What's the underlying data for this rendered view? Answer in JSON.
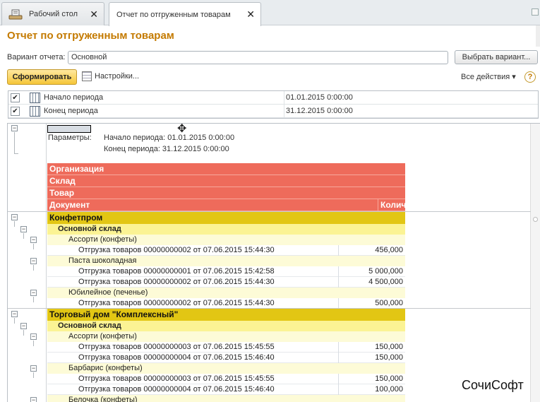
{
  "tabs": [
    {
      "label": "Рабочий стол",
      "active": false
    },
    {
      "label": "Отчет по отгруженным товарам",
      "active": true
    }
  ],
  "page_title": "Отчет по отгруженным товарам",
  "variant": {
    "label": "Вариант отчета:",
    "value": "Основной",
    "choose_button": "Выбрать вариант..."
  },
  "toolbar": {
    "generate": "Сформировать",
    "settings": "Настройки...",
    "all_actions": "Все действия ▾",
    "help": "?"
  },
  "parameters": [
    {
      "checked": true,
      "label": "Начало периода",
      "value": "01.01.2015 0:00:00"
    },
    {
      "checked": true,
      "label": "Конец периода",
      "value": "31.12.2015 0:00:00"
    }
  ],
  "report": {
    "params_label": "Параметры:",
    "params_lines": [
      "Начало периода: 01.01.2015 0:00:00",
      "Конец периода: 31.12.2015 0:00:00"
    ],
    "headers": [
      "Организация",
      "Склад",
      "Товар"
    ],
    "doc_header": "Документ",
    "qty_header": "Количество",
    "rows": [
      {
        "level": 1,
        "text": "Конфетпром",
        "qty": ""
      },
      {
        "level": 2,
        "text": "Основной склад",
        "qty": ""
      },
      {
        "level": 3,
        "text": "Ассорти (конфеты)",
        "qty": ""
      },
      {
        "level": 4,
        "text": "Отгрузка товаров 00000000002 от 07.06.2015 15:44:30",
        "qty": "456,000"
      },
      {
        "level": 3,
        "text": "Паста шоколадная",
        "qty": ""
      },
      {
        "level": 4,
        "text": "Отгрузка товаров 00000000001 от 07.06.2015 15:42:58",
        "qty": "5 000,000"
      },
      {
        "level": 4,
        "text": "Отгрузка товаров 00000000002 от 07.06.2015 15:44:30",
        "qty": "4 500,000"
      },
      {
        "level": 3,
        "text": "Юбилейное (печенье)",
        "qty": ""
      },
      {
        "level": 4,
        "text": "Отгрузка товаров 00000000002 от 07.06.2015 15:44:30",
        "qty": "500,000"
      },
      {
        "level": 1,
        "text": "Торговый дом \"Комплексный\"",
        "qty": ""
      },
      {
        "level": 2,
        "text": "Основной склад",
        "qty": ""
      },
      {
        "level": 3,
        "text": "Ассорти (конфеты)",
        "qty": ""
      },
      {
        "level": 4,
        "text": "Отгрузка товаров 00000000003 от 07.06.2015 15:45:55",
        "qty": "150,000"
      },
      {
        "level": 4,
        "text": "Отгрузка товаров 00000000004 от 07.06.2015 15:46:40",
        "qty": "150,000"
      },
      {
        "level": 3,
        "text": "Барбарис (конфеты)",
        "qty": ""
      },
      {
        "level": 4,
        "text": "Отгрузка товаров 00000000003 от 07.06.2015 15:45:55",
        "qty": "150,000"
      },
      {
        "level": 4,
        "text": "Отгрузка товаров 00000000004 от 07.06.2015 15:46:40",
        "qty": "100,000"
      },
      {
        "level": 3,
        "text": "Белочка (конфеты)",
        "qty": ""
      }
    ]
  },
  "watermark": "СочиСофт"
}
